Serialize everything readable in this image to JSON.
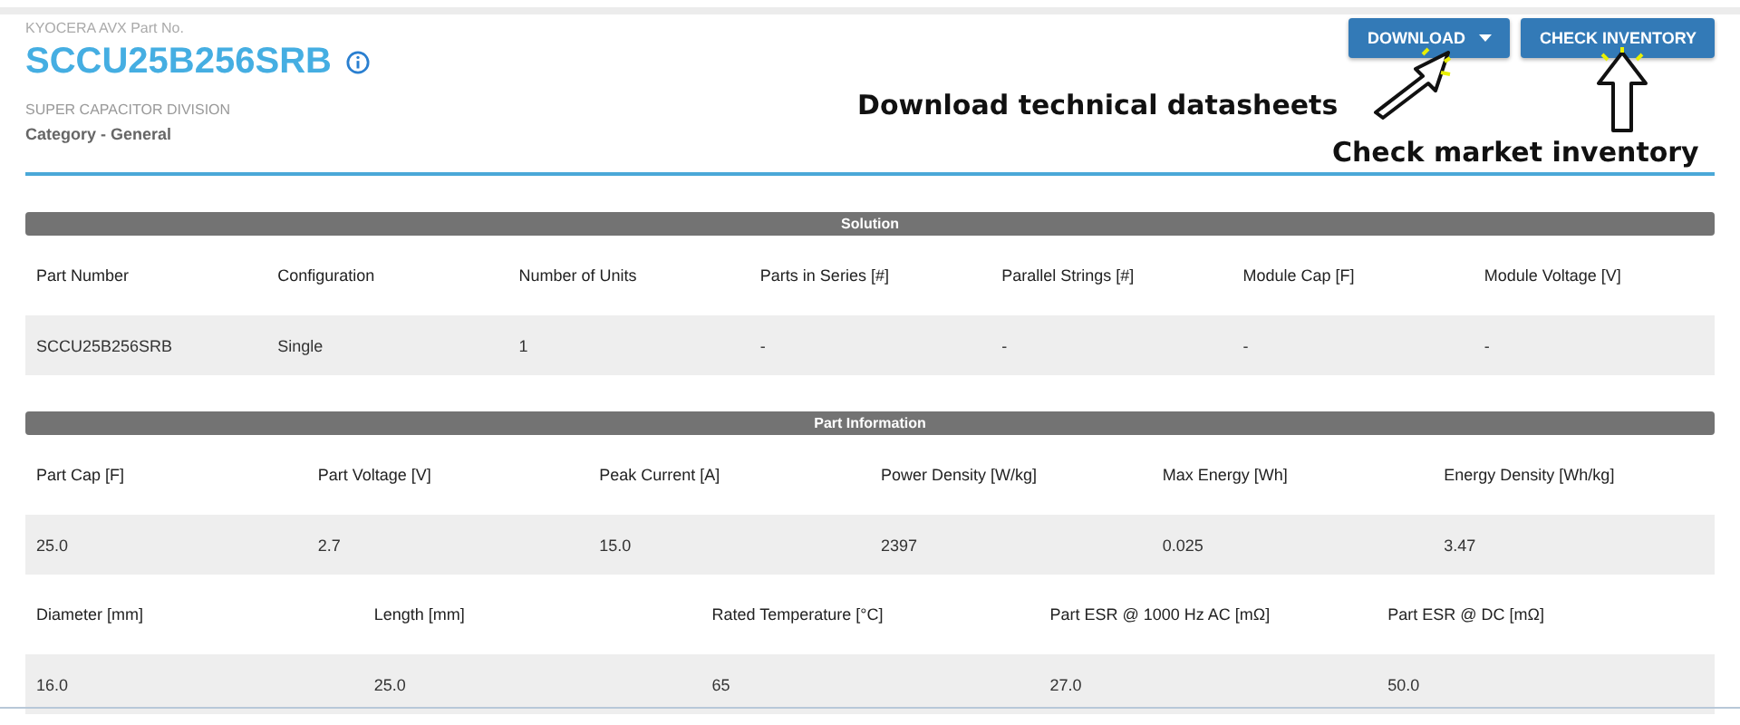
{
  "header": {
    "brand_label": "KYOCERA AVX Part No.",
    "part_number": "SCCU25B256SRB",
    "division": "SUPER CAPACITOR DIVISION",
    "category": "Category - General"
  },
  "buttons": [
    {
      "label": "DOWNLOAD",
      "kind": "dropdown"
    },
    {
      "label": "CHECK INVENTORY",
      "kind": "plain"
    }
  ],
  "annotations": [
    {
      "text": "Download technical datasheets",
      "kind": "diagonal"
    },
    {
      "text": "Check market inventory",
      "kind": "up"
    }
  ],
  "sections": [
    {
      "title": "Solution",
      "tables": [
        {
          "columns": [
            "Part Number",
            "Configuration",
            "Number of Units",
            "Parts in Series [#]",
            "Parallel Strings [#]",
            "Module Cap [F]",
            "Module Voltage [V]"
          ],
          "rows": [
            [
              "SCCU25B256SRB",
              "Single",
              "1",
              "-",
              "-",
              "-",
              "-"
            ]
          ]
        }
      ]
    },
    {
      "title": "Part Information",
      "tables": [
        {
          "columns": [
            "Part Cap [F]",
            "Part Voltage [V]",
            "Peak Current [A]",
            "Power Density [W/kg]",
            "Max Energy [Wh]",
            "Energy Density [Wh/kg]"
          ],
          "rows": [
            [
              "25.0",
              "2.7",
              "15.0",
              "2397",
              "0.025",
              "3.47"
            ]
          ]
        },
        {
          "columns": [
            "Diameter [mm]",
            "Length [mm]",
            "Rated Temperature [°C]",
            "Part ESR @ 1000 Hz AC [mΩ]",
            "Part ESR @ DC [mΩ]"
          ],
          "rows": [
            [
              "16.0",
              "25.0",
              "65",
              "27.0",
              "50.0"
            ]
          ]
        }
      ]
    }
  ]
}
